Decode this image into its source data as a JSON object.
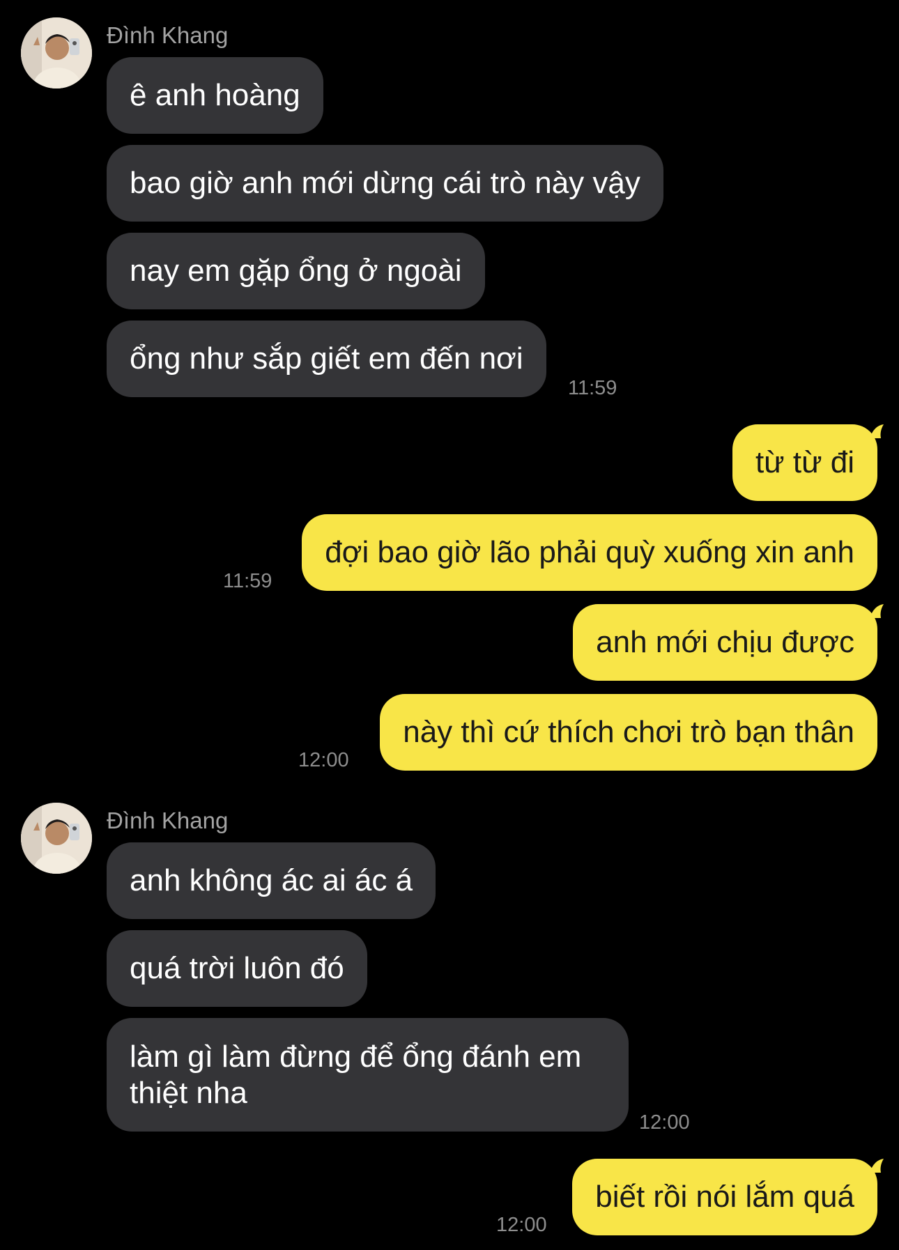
{
  "colors": {
    "background": "#000000",
    "incoming_bubble": "#343437",
    "outgoing_bubble": "#f8e548",
    "sender_name": "#a3a3a3",
    "timestamp": "#8e8e8e"
  },
  "chat": {
    "groups": [
      {
        "direction": "incoming",
        "sender": "Đình Khang",
        "avatar_icon": "avatar-photo-icon",
        "messages": [
          "ê anh hoàng",
          "bao giờ anh mới dừng cái trò này vậy",
          "nay em gặp ổng ở ngoài",
          "ổng như sắp giết em đến nơi"
        ],
        "time": "11:59"
      },
      {
        "direction": "outgoing",
        "messages": [
          "từ từ đi",
          "đợi bao giờ lão phải quỳ xuống xin anh"
        ],
        "time": "11:59"
      },
      {
        "direction": "outgoing",
        "messages": [
          "anh mới chịu được",
          "này thì cứ thích chơi trò bạn thân"
        ],
        "time": "12:00"
      },
      {
        "direction": "incoming",
        "sender": "Đình Khang",
        "avatar_icon": "avatar-photo-icon",
        "messages": [
          "anh không ác ai ác á",
          "quá trời luôn đó",
          "làm gì làm đừng để ổng đánh em thiệt nha"
        ],
        "time": "12:00"
      },
      {
        "direction": "outgoing",
        "messages": [
          "biết rồi nói lắm quá"
        ],
        "time": "12:00"
      }
    ]
  }
}
